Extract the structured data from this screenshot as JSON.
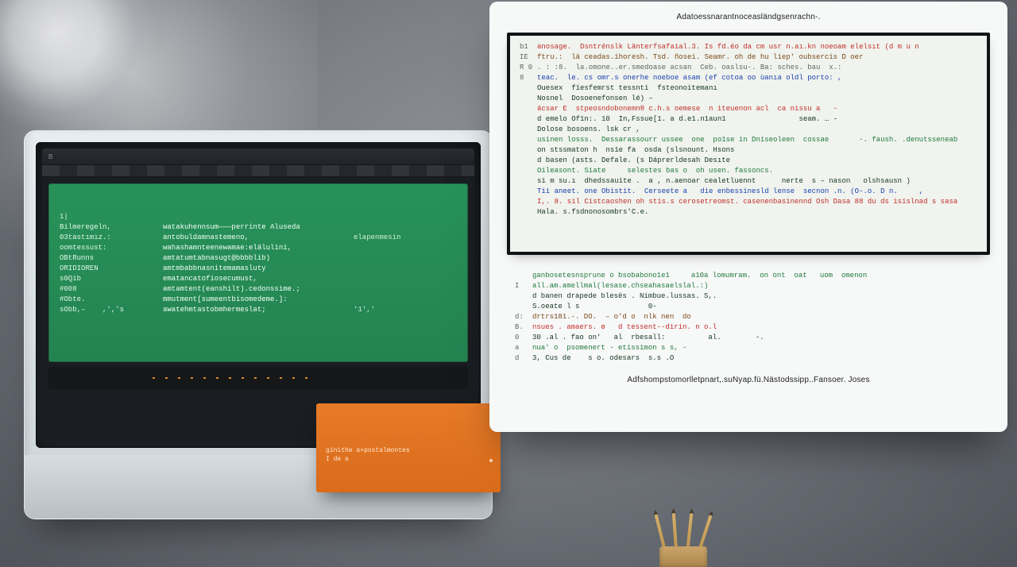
{
  "image_kind": "stylized illustration — text is decorative/unreadable glyph-like strokes, not real words",
  "left_monitor": {
    "title_tab": "B",
    "terminal_rows": [
      {
        "a": "1|",
        "b": "",
        "c": ""
      },
      {
        "a": "Bilmeregeln,",
        "b": "watakuhennsum———perrinte Aluseda",
        "c": ""
      },
      {
        "a": "03tastımız.:",
        "b": "antobuldamnastemeno,",
        "c": "elapenmesin"
      },
      {
        "a": "oomtessust:",
        "b": "wahashamnteenewamae:elälulini,",
        "c": ""
      },
      {
        "a": "OBtRunns",
        "b": "amtatumtabnasugt@bbbblib)",
        "c": ""
      },
      {
        "a": "ORIDIOREN",
        "b": "amtmbabbnasnitemamasluty",
        "c": ""
      },
      {
        "a": "s0Qib",
        "b": "ematancatofiosecumust,",
        "c": ""
      },
      {
        "a": "#008",
        "b": "amtamtent(eanshilt).cedonssime.;",
        "c": ""
      },
      {
        "a": "#Obte.",
        "b": "mmutment[sumeentbisomedeme.]:",
        "c": ""
      },
      {
        "a": "sObb,–    ,','s",
        "b": "awatehmtastobmhermeslat;",
        "c": "'1','"
      }
    ]
  },
  "note": {
    "line1": "ginithe a+postalmontes",
    "line2": "I de a"
  },
  "doc": {
    "top_caption": "Adatoessnarantnoceasländgsenrachn-.",
    "framed_lines": [
      {
        "gut": "b1",
        "cls": "kw-red",
        "t": "anosage.  Dsntrénslk Länterfsafaial.3. Is fd.éo da cm usr n.aı.kn noeoam elelsıt (d m u n"
      },
      {
        "gut": "IE",
        "cls": "kw-brown",
        "t": "ftru.:  lä ceadas.ihoresh. Tsd. ñosei. Seamr. oh de hu liep' oubsercis D oer"
      },
      {
        "gut": "R 0",
        "cls": "kw-gr",
        "t": ". : :8.  la.omone..er.smedoase acsan  Ceb. oaslsu-. Ba: sches. bau  x.:"
      },
      {
        "gut": "8",
        "cls": "kw-blue",
        "t": "teac.  le. cs omr.s onerhe noeboe asam (ef cotoa oo ùanıa oldl porto: ,"
      },
      {
        "gut": "",
        "cls": "kw-dk",
        "t": "Ouesex  fïesfemrst tessnti  fsteonoitemanı"
      },
      {
        "gut": "",
        "cls": "kw-dk",
        "t": "Nosnel  Dosoenefonsen lé) –"
      },
      {
        "gut": "",
        "cls": "kw-red",
        "t": "ácsar E  stpeosndobonemn® c.h.s oemese  n iteuenon acl  ca nissu a   -"
      },
      {
        "gut": "",
        "cls": "kw-dk",
        "t": "d emelo Of1n:. 10  In,Fssue[1. a d.e1.n1aun1                 seam. … -"
      },
      {
        "gut": "",
        "cls": "kw-dk",
        "t": "Dolose bosoens. lsk cr ,"
      },
      {
        "gut": "",
        "cls": "kw-green",
        "t": "usinen losss.  Dessarassourr ussee  one  po1se in Dniseoleen  cossae       -. faush. .denutsseneab"
      },
      {
        "gut": "",
        "cls": "kw-dk",
        "t": "on stssmaton h  ns1e fa  osda (slsnount. Hsons"
      },
      {
        "gut": "",
        "cls": "kw-dk",
        "t": "d basen (asts. Defale. (s Dáprerldesah Desıte"
      },
      {
        "gut": "",
        "cls": "kw-green",
        "t": "Oileasont. Siate     selestes bas o  oh usen. fassoncs."
      },
      {
        "gut": "",
        "cls": "kw-dk",
        "t": "si m su.ı  dhedssauite .  a , n.aenoar cealetluennt      nerte  s – nason   olshsausn )"
      },
      {
        "gut": "",
        "cls": "kw-blue",
        "t": "Tii aneet. one Obistit.  Cerseete a   die enbessinesld lense  secnon .n. (O-.o. D n.     ,"
      },
      {
        "gut": "",
        "cls": "kw-red",
        "t": "I,. 8. sil Cistcaoshen oh stis.s cerosetreomst. casenenbasinennd Osh Dasa 88 du ds isislnad s sasa"
      },
      {
        "gut": "",
        "cls": "kw-dk",
        "t": "Hala. s.fsdnonosombrs'C.e."
      }
    ],
    "lower_lines": [
      {
        "gut": "",
        "cls": "kw-green",
        "t": "ganbosetesnsprune o bsobabono1e1     a10a lomumram.  on ont  oat   uom  omenon"
      },
      {
        "gut": "I",
        "cls": "kw-green",
        "t": "all.am.amellmal(lesase.chseahasaelslal.:)"
      },
      {
        "gut": "",
        "cls": "kw-dk",
        "t": "d banen drapede blesës . Nimbue.lussas. S,."
      },
      {
        "gut": "",
        "cls": "kw-dk",
        "t": "S.oeate l s                0-"
      },
      {
        "gut": "d:",
        "cls": "kw-brown",
        "t": "drtrs181.-. DO.  – o'd o  nlk nen  do"
      },
      {
        "gut": "B.",
        "cls": "kw-red",
        "t": "nsues . amaers. ø   d tessent--dirin. n o.l"
      },
      {
        "gut": "0",
        "cls": "kw-dk",
        "t": "30 .al . fao on'   al  rbesall:          al.        -."
      },
      {
        "gut": "a",
        "cls": "kw-green",
        "t": "nua' o  psomenert - etissimon s s, -"
      },
      {
        "gut": "d",
        "cls": "kw-dk",
        "t": "3, Cus de    s o. odesars  s.s .O"
      }
    ],
    "bottom_caption": "Adfshompstomorlletpnart,.suNyap.fü.Nästodssipp..Fansoer. Joses"
  }
}
